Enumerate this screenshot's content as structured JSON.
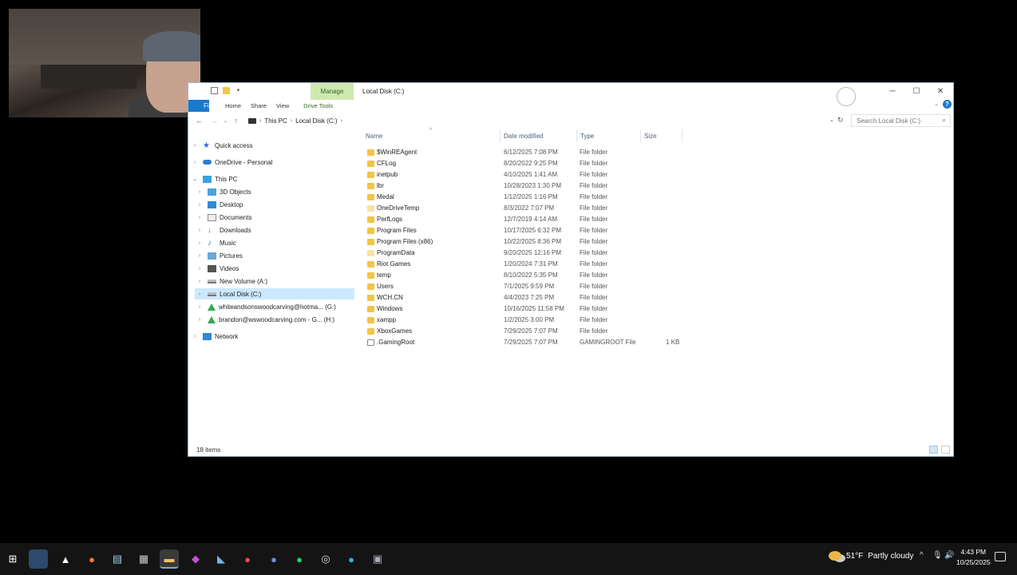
{
  "window": {
    "title": "Local Disk (C:)",
    "manage_tab": "Manage",
    "ribbon": {
      "file": "File",
      "tabs": [
        "Home",
        "Share",
        "View"
      ],
      "drive_tools": "Drive Tools"
    },
    "address": {
      "crumbs": [
        "This PC",
        "Local Disk (C:)"
      ]
    },
    "search": {
      "placeholder": "Search Local Disk (C:)"
    },
    "columns": {
      "name": "Name",
      "date": "Date modified",
      "type": "Type",
      "size": "Size"
    },
    "status": "18 items"
  },
  "nav_pane": [
    {
      "label": "Quick access",
      "icon": "star-icon",
      "color": "#1e6fd9"
    },
    {
      "label": "OneDrive - Personal",
      "icon": "cloud-icon",
      "color": "#2b7cd3"
    },
    {
      "label": "This PC",
      "icon": "computer-icon",
      "color": "#3aa0e0"
    },
    {
      "label": "3D Objects",
      "icon": "cube-icon",
      "color": "#4aa3df"
    },
    {
      "label": "Desktop",
      "icon": "desktop-icon",
      "color": "#2d8ad7"
    },
    {
      "label": "Documents",
      "icon": "document-icon",
      "color": "#8a8a8a"
    },
    {
      "label": "Downloads",
      "icon": "download-icon",
      "color": "#2d8ad7"
    },
    {
      "label": "Music",
      "icon": "music-icon",
      "color": "#2d8ad7"
    },
    {
      "label": "Pictures",
      "icon": "picture-icon",
      "color": "#6ba8d8"
    },
    {
      "label": "Videos",
      "icon": "video-icon",
      "color": "#555555"
    },
    {
      "label": "New Volume (A:)",
      "icon": "drive-icon",
      "color": "#777777"
    },
    {
      "label": "Local Disk (C:)",
      "icon": "drive-icon",
      "color": "#777777"
    },
    {
      "label": "whiteandsonswoodcarving@hotma... (G:)",
      "icon": "google-drive-icon",
      "color": "#34a853"
    },
    {
      "label": "brandon@wswoodcarving.com - G... (H:)",
      "icon": "google-drive-icon",
      "color": "#34a853"
    },
    {
      "label": "Network",
      "icon": "network-icon",
      "color": "#2d8ad7"
    }
  ],
  "files": [
    {
      "name": "$WinREAgent",
      "date": "6/12/2025 7:08 PM",
      "type": "File folder",
      "size": ""
    },
    {
      "name": "CFLog",
      "date": "8/20/2022 9:25 PM",
      "type": "File folder",
      "size": ""
    },
    {
      "name": "inetpub",
      "date": "4/10/2025 1:41 AM",
      "type": "File folder",
      "size": ""
    },
    {
      "name": "lbr",
      "date": "10/28/2023 1:30 PM",
      "type": "File folder",
      "size": ""
    },
    {
      "name": "Medal",
      "date": "1/12/2025 1:16 PM",
      "type": "File folder",
      "size": ""
    },
    {
      "name": "OneDriveTemp",
      "date": "8/3/2022 7:07 PM",
      "type": "File folder",
      "size": ""
    },
    {
      "name": "PerfLogs",
      "date": "12/7/2019 4:14 AM",
      "type": "File folder",
      "size": ""
    },
    {
      "name": "Program Files",
      "date": "10/17/2025 6:32 PM",
      "type": "File folder",
      "size": ""
    },
    {
      "name": "Program Files (x86)",
      "date": "10/22/2025 8:36 PM",
      "type": "File folder",
      "size": ""
    },
    {
      "name": "ProgramData",
      "date": "9/20/2025 12:16 PM",
      "type": "File folder",
      "size": ""
    },
    {
      "name": "Riot Games",
      "date": "1/20/2024 7:31 PM",
      "type": "File folder",
      "size": ""
    },
    {
      "name": "temp",
      "date": "8/10/2022 5:35 PM",
      "type": "File folder",
      "size": ""
    },
    {
      "name": "Users",
      "date": "7/1/2025 9:59 PM",
      "type": "File folder",
      "size": ""
    },
    {
      "name": "WCH.CN",
      "date": "4/4/2023 7:25 PM",
      "type": "File folder",
      "size": ""
    },
    {
      "name": "Windows",
      "date": "10/16/2025 11:58 PM",
      "type": "File folder",
      "size": ""
    },
    {
      "name": "xampp",
      "date": "1/2/2025 3:00 PM",
      "type": "File folder",
      "size": ""
    },
    {
      "name": "XboxGames",
      "date": "7/29/2025 7:07 PM",
      "type": "File folder",
      "size": ""
    },
    {
      "name": ".GamingRoot",
      "date": "7/29/2025 7:07 PM",
      "type": "GAMINGROOT File",
      "size": "1 KB"
    }
  ],
  "taskbar": {
    "weather": {
      "temp": "51°F",
      "condition": "Partly cloudy"
    },
    "time": "4:43 PM",
    "date": "10/25/2025",
    "apps": [
      "windows-icon",
      "task-manager-icon",
      "steam-icon",
      "firefox-icon",
      "notepad-icon",
      "calculator-icon",
      "file-explorer-icon",
      "app-icon",
      "steam-icon",
      "maps-icon",
      "discord-icon",
      "spotify-icon",
      "obs-icon",
      "edge-icon",
      "app-icon"
    ]
  }
}
